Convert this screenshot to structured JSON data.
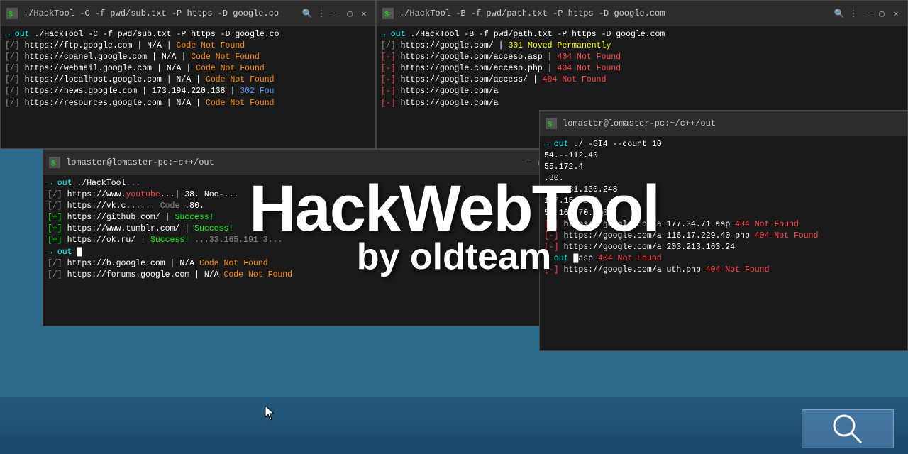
{
  "windows": [
    {
      "id": "win1",
      "title": "./HackTool -C -f pwd/sub.txt -P https -D google.co",
      "lines": [
        {
          "parts": [
            {
              "text": "→ out ",
              "cls": "t-cyan"
            },
            {
              "text": "./HackTool -C -f pwd/sub.txt -P https -D google.co",
              "cls": "t-white"
            }
          ]
        },
        {
          "parts": [
            {
              "text": "[/] ",
              "cls": "t-gray"
            },
            {
              "text": "https://ftp.google.com | N/A | ",
              "cls": "t-white"
            },
            {
              "text": "Code Not Found",
              "cls": "t-orange"
            }
          ]
        },
        {
          "parts": [
            {
              "text": "[/] ",
              "cls": "t-gray"
            },
            {
              "text": "https://cpanel.google.com | N/A | ",
              "cls": "t-white"
            },
            {
              "text": "Code Not Found",
              "cls": "t-orange"
            }
          ]
        },
        {
          "parts": [
            {
              "text": "[/] ",
              "cls": "t-gray"
            },
            {
              "text": "https://webmail.google.com | N/A | ",
              "cls": "t-white"
            },
            {
              "text": "Code Not Found",
              "cls": "t-orange"
            }
          ]
        },
        {
          "parts": [
            {
              "text": "[/] ",
              "cls": "t-gray"
            },
            {
              "text": "https://localhost.google.com | N/A | ",
              "cls": "t-white"
            },
            {
              "text": "Code Not Foun",
              "cls": "t-orange"
            }
          ]
        },
        {
          "parts": [
            {
              "text": "[/] ",
              "cls": "t-gray"
            },
            {
              "text": "https://news.google.com | 173.194.220.138 | ",
              "cls": "t-white"
            },
            {
              "text": "302 Fou",
              "cls": "t-blue"
            }
          ]
        },
        {
          "parts": [
            {
              "text": "[/] ",
              "cls": "t-gray"
            },
            {
              "text": "https://resources.google.com | N/A | ",
              "cls": "t-white"
            },
            {
              "text": "Code Not Found",
              "cls": "t-orange"
            }
          ]
        }
      ]
    },
    {
      "id": "win2",
      "title": "./HackTool -B -f pwd/path.txt -P https -D google.com",
      "lines": [
        {
          "parts": [
            {
              "text": "→ out ",
              "cls": "t-cyan"
            },
            {
              "text": "./HackTool -B -f pwd/path.txt -P https -D google.com",
              "cls": "t-white"
            }
          ]
        },
        {
          "parts": [
            {
              "text": "[/] ",
              "cls": "t-gray"
            },
            {
              "text": "https://google.com/ | ",
              "cls": "t-white"
            },
            {
              "text": "301 Moved Permanently",
              "cls": "t-yellow"
            }
          ]
        },
        {
          "parts": [
            {
              "text": "[-] ",
              "cls": "t-red"
            },
            {
              "text": "https://google.com/acceso.asp | ",
              "cls": "t-white"
            },
            {
              "text": "404 Not Found",
              "cls": "t-red"
            }
          ]
        },
        {
          "parts": [
            {
              "text": "[-] ",
              "cls": "t-red"
            },
            {
              "text": "https://google.com/acceso.php | ",
              "cls": "t-white"
            },
            {
              "text": "404 Not Found",
              "cls": "t-red"
            }
          ]
        },
        {
          "parts": [
            {
              "text": "[-] ",
              "cls": "t-red"
            },
            {
              "text": "https://google.com/access/ | ",
              "cls": "t-white"
            },
            {
              "text": "404 Not Found",
              "cls": "t-red"
            }
          ]
        },
        {
          "parts": [
            {
              "text": "[-] ",
              "cls": "t-red"
            },
            {
              "text": "https://google.com/a",
              "cls": "t-white"
            }
          ]
        },
        {
          "parts": [
            {
              "text": "[-] ",
              "cls": "t-red"
            },
            {
              "text": "https://google.com/a",
              "cls": "t-white"
            }
          ]
        }
      ]
    },
    {
      "id": "win3",
      "title": "lomaster@lomaster-pc:~c++/out",
      "lines": [
        {
          "parts": [
            {
              "text": "→ out ",
              "cls": "t-cyan"
            },
            {
              "text": "./HackTool",
              "cls": "t-white"
            },
            {
              "text": "...",
              "cls": "t-gray"
            }
          ]
        },
        {
          "parts": [
            {
              "text": "[/] ",
              "cls": "t-gray"
            },
            {
              "text": "https://www.",
              "cls": "t-white"
            },
            {
              "text": "youtube",
              "cls": "t-red"
            },
            {
              "text": "...| 38.",
              "cls": "t-white"
            }
          ]
        },
        {
          "parts": [
            {
              "text": "[/] ",
              "cls": "t-gray"
            },
            {
              "text": "https://vk.c",
              "cls": "t-white"
            },
            {
              "text": "...",
              "cls": "t-gray"
            },
            {
              "text": ".80. ",
              "cls": "t-white"
            }
          ]
        },
        {
          "parts": [
            {
              "text": "[+] ",
              "cls": "t-green"
            },
            {
              "text": "https://github.com/ | ",
              "cls": "t-white"
            },
            {
              "text": "Success!",
              "cls": "t-green"
            }
          ]
        },
        {
          "parts": [
            {
              "text": "[+] ",
              "cls": "t-green"
            },
            {
              "text": "https://www.tumblr.com/ | ",
              "cls": "t-white"
            },
            {
              "text": "Success!",
              "cls": "t-green"
            }
          ]
        },
        {
          "parts": [
            {
              "text": "[+] ",
              "cls": "t-green"
            },
            {
              "text": "https://ok.ru/ | ",
              "cls": "t-white"
            },
            {
              "text": "Success!",
              "cls": "t-green"
            }
          ]
        },
        {
          "parts": [
            {
              "text": "→ out ",
              "cls": "t-cyan"
            },
            {
              "text": "█",
              "cls": "t-white"
            }
          ]
        },
        {
          "parts": [
            {
              "text": "[/] ",
              "cls": "t-gray"
            },
            {
              "text": "https://b.google.com | N/A ",
              "cls": "t-white"
            },
            {
              "text": "Code Not Found",
              "cls": "t-orange"
            }
          ]
        },
        {
          "parts": [
            {
              "text": "[/] ",
              "cls": "t-gray"
            },
            {
              "text": "https://forums.google.com | N/A   ",
              "cls": "t-white"
            },
            {
              "text": "Code Not Found",
              "cls": "t-orange"
            }
          ]
        }
      ]
    },
    {
      "id": "win4",
      "title": "lomaster@lomaster-pc:~/c++/out",
      "lines": [
        {
          "parts": [
            {
              "text": "→ out ",
              "cls": "t-cyan"
            },
            {
              "text": "./ -GI4 --count 10",
              "cls": "t-white"
            }
          ]
        },
        {
          "parts": [
            {
              "text": "     ",
              "cls": ""
            },
            {
              "text": "54.--",
              "cls": "t-white"
            },
            {
              "text": "112.40",
              "cls": "t-white"
            }
          ]
        },
        {
          "parts": [
            {
              "text": "     ",
              "cls": ""
            },
            {
              "text": "55.172",
              "cls": "t-white"
            },
            {
              "text": ".4",
              "cls": "t-white"
            }
          ]
        },
        {
          "parts": [
            {
              "text": "     ",
              "cls": ""
            },
            {
              "text": ".80.",
              "cls": "t-white"
            }
          ]
        },
        {
          "parts": [
            {
              "text": "     ",
              "cls": ""
            },
            {
              "text": "251.231.130.248",
              "cls": "t-white"
            }
          ]
        },
        {
          "parts": [
            {
              "text": "     ",
              "cls": ""
            },
            {
              "text": "147.154.223",
              "cls": "t-white"
            }
          ]
        },
        {
          "parts": [
            {
              "text": "     ",
              "cls": ""
            },
            {
              "text": "55.161.70.220",
              "cls": "t-white"
            }
          ]
        },
        {
          "parts": [
            {
              "text": "[-] ",
              "cls": "t-red"
            },
            {
              "text": "https://google.com/a  177.34.71  asp   ",
              "cls": "t-white"
            },
            {
              "text": "404 Not Found",
              "cls": "t-red"
            }
          ]
        },
        {
          "parts": [
            {
              "text": "[-] ",
              "cls": "t-red"
            },
            {
              "text": "https://google.com/a  116.17.229.40  php   ",
              "cls": "t-white"
            },
            {
              "text": "404 Not Found",
              "cls": "t-red"
            }
          ]
        },
        {
          "parts": [
            {
              "text": "[-] ",
              "cls": "t-red"
            },
            {
              "text": "https://google.com/a  203.213.163.24",
              "cls": "t-white"
            }
          ]
        },
        {
          "parts": [
            {
              "text": "→ out ",
              "cls": "t-cyan"
            },
            {
              "text": "█",
              "cls": "t-white"
            },
            {
              "text": "asp   ",
              "cls": "t-white"
            },
            {
              "text": "404 Not Found",
              "cls": "t-red"
            }
          ]
        },
        {
          "parts": [
            {
              "text": "[-] ",
              "cls": "t-red"
            },
            {
              "text": "https://google.com/a  uth.php   ",
              "cls": "t-white"
            },
            {
              "text": "404 Not Found",
              "cls": "t-red"
            }
          ]
        }
      ]
    }
  ],
  "overlay": {
    "title": "HackWebTool",
    "subtitle": "by oldteam"
  },
  "win4_hostname": "lomaster@lomaster-pc:~/c++/out"
}
